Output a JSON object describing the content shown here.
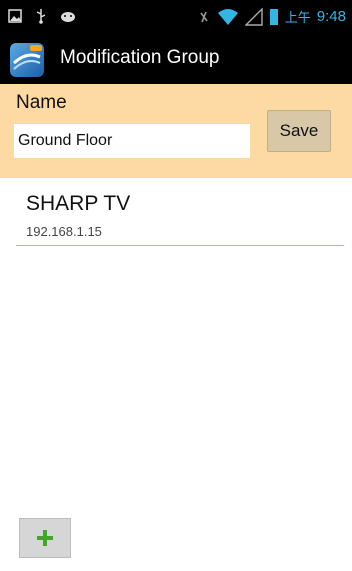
{
  "status_bar": {
    "ime_text": "上午",
    "time": "9:48",
    "icons": [
      "image-icon",
      "usb-icon",
      "android-icon",
      "mute-icon",
      "wifi-icon",
      "signal-icon",
      "battery-icon"
    ]
  },
  "action_bar": {
    "app_icon": "rcc-app-icon",
    "title": "Modification Group"
  },
  "name_panel": {
    "label": "Name",
    "input_value": "Ground Floor",
    "save_label": "Save",
    "background": "#fdd9a3"
  },
  "devices": [
    {
      "name": "SHARP TV",
      "ip": "192.168.1.15"
    }
  ],
  "add_button": {
    "icon": "plus-icon",
    "color": "#41a62a"
  }
}
